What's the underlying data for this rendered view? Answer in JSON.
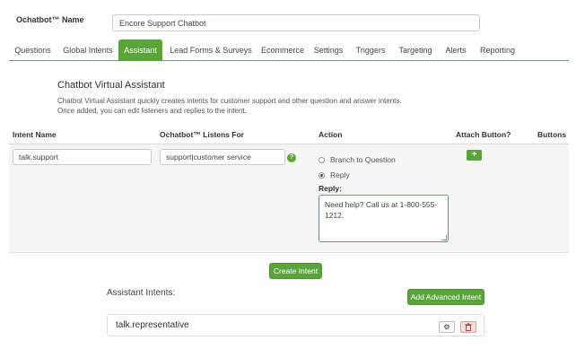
{
  "header": {
    "name_label": "Ochatbot™ Name",
    "name_value": "Encore Support Chatbot"
  },
  "tabs": [
    {
      "label": "Questions",
      "active": false
    },
    {
      "label": "Global Intents",
      "active": false
    },
    {
      "label": "Assistant",
      "active": true
    },
    {
      "label": "Lead Forms & Surveys",
      "active": false
    },
    {
      "label": "Ecommerce",
      "active": false
    },
    {
      "label": "Settings",
      "active": false
    },
    {
      "label": "Triggers",
      "active": false
    },
    {
      "label": "Targeting",
      "active": false
    },
    {
      "label": "Alerts",
      "active": false
    },
    {
      "label": "Reporting",
      "active": false
    }
  ],
  "section": {
    "title": "Chatbot Virtual Assistant",
    "desc_line1": "Chatbot Virtual Assistant quickly creates intents for customer support and other question and answer intents.",
    "desc_line2": "Once added, you can edit listeners and replies to the intent."
  },
  "columns": {
    "intent_name": "Intent Name",
    "listens_for": "Ochatbot™ Listens For",
    "action": "Action",
    "attach_button": "Attach Button?",
    "buttons": "Buttons"
  },
  "form": {
    "intent_name_value": "talk.support",
    "listens_for_value": "support|customer service",
    "help_icon_glyph": "?",
    "action_options": [
      {
        "label": "Branch to Question",
        "checked": false
      },
      {
        "label": "Reply",
        "checked": true
      }
    ],
    "reply_label": "Reply:",
    "reply_value": "Need help? Call us at 1-800-555-1212.",
    "plus_glyph": "+"
  },
  "buttons": {
    "create_intent": "Create Intent",
    "add_advanced_intent": "Add Advanced Intent"
  },
  "assistant_intents": {
    "title": "Assistant Intents:",
    "items": [
      {
        "name": "talk.representative",
        "gear_icon": "gear-icon",
        "trash_icon": "trash-icon"
      }
    ]
  },
  "colors": {
    "accent_green": "#5aa53a",
    "trash_bg": "#f4dede"
  }
}
